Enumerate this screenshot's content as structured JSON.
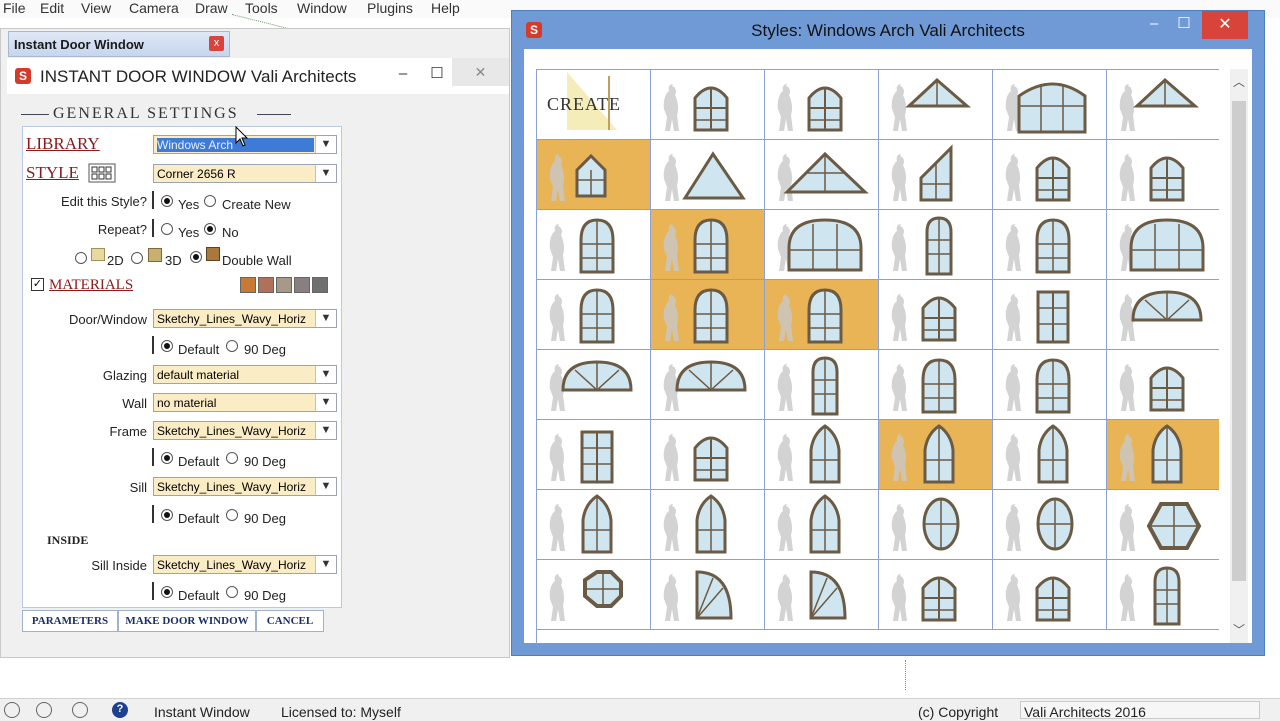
{
  "menu": [
    "File",
    "Edit",
    "View",
    "Camera",
    "Draw",
    "Tools",
    "Window",
    "Plugins",
    "Help"
  ],
  "tray": {
    "title": "Instant Door Window",
    "close": "x"
  },
  "plugin": {
    "title": "INSTANT DOOR WINDOW   Vali Architects",
    "minimize": "–",
    "maximize": "☐",
    "close": "✕",
    "section_header": "GENERAL  SETTINGS",
    "library_label": "LIBRARY",
    "library_value": "Windows Arch",
    "style_label": "STYLE",
    "style_value": "Corner 2656 R",
    "edit_style_label": "Edit this Style?",
    "edit_yes": "Yes",
    "edit_create": "Create New",
    "repeat_label": "Repeat?",
    "repeat_yes": "Yes",
    "repeat_no": "No",
    "mode_2d": "2D",
    "mode_3d": "3D",
    "mode_double": "Double Wall",
    "materials_label": "MATERIALS",
    "swatches": [
      "#c87a34",
      "#b0705a",
      "#a89888",
      "#888080",
      "#707070"
    ],
    "door_window_label": "Door/Window",
    "door_window_value": "Sketchy_Lines_Wavy_Horiz",
    "glazing_label": "Glazing",
    "glazing_value": "default material",
    "wall_label": "Wall",
    "wall_value": "no material",
    "frame_label": "Frame",
    "frame_value": "Sketchy_Lines_Wavy_Horiz",
    "sill_label": "Sill",
    "sill_value": "Sketchy_Lines_Wavy_Horiz",
    "inside_label": "INSIDE",
    "sill_inside_label": "Sill Inside",
    "sill_inside_value": "Sketchy_Lines_Wavy_Horiz",
    "default_label": "Default",
    "deg_label": "90 Deg",
    "btn_parameters": "PARAMETERS",
    "btn_make": "MAKE DOOR WINDOW",
    "btn_cancel": "CANCEL"
  },
  "styles": {
    "title": "Styles: Windows Arch    Vali Architects",
    "minimize": "–",
    "maximize": "☐",
    "close": "✕",
    "create_label": "CREATE",
    "icons": [
      "create",
      "rect-arch",
      "rect-arch",
      "triangle-flat",
      "wide-arch",
      "triangle-flat",
      "pentagon",
      "triangle",
      "triangle-wide",
      "trapezoid",
      "rect-arch",
      "rect-arch",
      "round-arch",
      "round-arch",
      "wide-round-arch",
      "tall-arch",
      "round-arch",
      "wide-round-arch",
      "round-arch",
      "round-arch",
      "round-arch",
      "rect-arch",
      "rect",
      "half-round",
      "half-round",
      "half-round",
      "tall-arch",
      "round-arch",
      "round-arch",
      "rect-arch",
      "rect",
      "rect-arch",
      "gothic",
      "gothic",
      "gothic",
      "gothic",
      "gothic",
      "gothic",
      "gothic",
      "oval",
      "oval",
      "hexagon",
      "octagon",
      "quarter-round",
      "quarter-round",
      "rect-arch",
      "rect-arch",
      "tall-arch"
    ],
    "highlighted": [
      6,
      13,
      19,
      20,
      33,
      35
    ]
  },
  "status": {
    "app": "Instant Window",
    "license": "Licensed to: Myself",
    "copyright": "(c) Copyright",
    "company": "Vali Architects 2016"
  }
}
